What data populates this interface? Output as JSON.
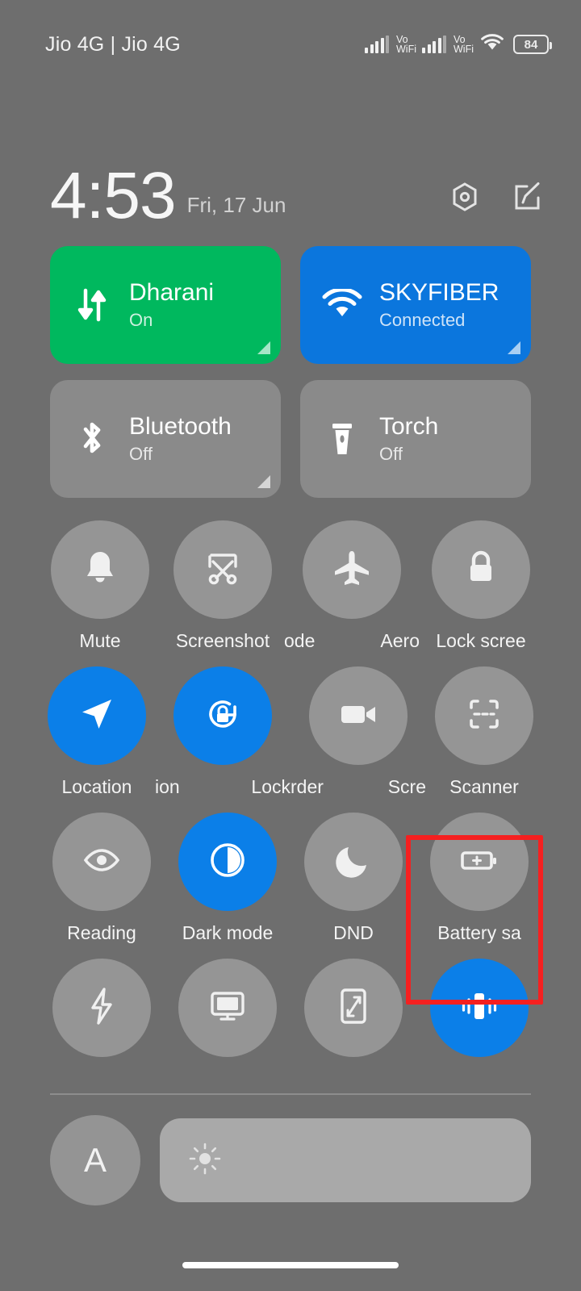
{
  "status_bar": {
    "carrier": "Jio 4G | Jio 4G",
    "signal_1_label": "Vo\nWiFi",
    "vo_top": "Vo",
    "vo_bottom": "WiFi",
    "battery_percent": "84",
    "icons": [
      "signal-bars-icon",
      "vowifi-icon",
      "signal-bars-icon",
      "vowifi-icon",
      "wifi-icon",
      "battery-icon"
    ]
  },
  "header": {
    "time": "4:53",
    "date": "Fri, 17 Jun",
    "settings_icon": "settings-gear-icon",
    "edit_icon": "edit-pencil-icon"
  },
  "big_tiles": [
    {
      "title": "Dharani",
      "subtitle": "On",
      "state": "green",
      "icon": "mobile-data-icon",
      "has_expand": true
    },
    {
      "title": "SKYFIBER",
      "subtitle": "Connected",
      "state": "blue",
      "icon": "wifi-icon",
      "has_expand": true
    },
    {
      "title": "Bluetooth",
      "subtitle": "Off",
      "state": "off",
      "icon": "bluetooth-icon",
      "has_expand": true
    },
    {
      "title": "Torch",
      "subtitle": "Off",
      "state": "off",
      "icon": "torch-icon",
      "has_expand": false
    }
  ],
  "toggle_rows": [
    {
      "tiles": [
        {
          "label": "Mute",
          "icon": "bell-icon",
          "active": false
        },
        {
          "label": "Screenshot",
          "icon": "screenshot-icon",
          "active": false
        },
        {
          "label": "ode",
          "icon": "airplane-icon",
          "active": false
        },
        {
          "label": "Aero",
          "icon": "lock-icon",
          "active": false
        },
        {
          "label": "Lock scree",
          "icon": "lock-icon",
          "active": false
        }
      ]
    }
  ],
  "row1": [
    {
      "label": "Mute",
      "icon": "bell-icon",
      "active": false
    },
    {
      "label": "Screenshot",
      "icon": "screenshot-icon",
      "active": false
    },
    {
      "label": "ode",
      "icon": "airplane-icon",
      "active": false,
      "label2": "Aero"
    },
    {
      "label": "Lock scree",
      "icon": "lock-icon",
      "active": false
    }
  ],
  "row2": [
    {
      "label": "Location",
      "icon": "location-arrow-icon",
      "active": true
    },
    {
      "label": "ion",
      "icon": "rotation-lock-icon",
      "active": true,
      "label2": "Lock"
    },
    {
      "label": "rder",
      "icon": "screen-recorder-icon",
      "active": false,
      "label2": "Scre"
    },
    {
      "label": "Scanner",
      "icon": "scanner-icon",
      "active": false
    }
  ],
  "row3": [
    {
      "label": "Reading",
      "icon": "eye-icon",
      "active": false
    },
    {
      "label": "Dark mode",
      "icon": "dark-mode-icon",
      "active": true
    },
    {
      "label": "DND",
      "icon": "moon-icon",
      "active": false
    },
    {
      "label": "Battery sa",
      "icon": "battery-saver-icon",
      "active": false,
      "highlighted": true
    }
  ],
  "row4": [
    {
      "label": "",
      "icon": "lightning-bolt-icon",
      "active": false
    },
    {
      "label": "",
      "icon": "cast-screen-icon",
      "active": false
    },
    {
      "label": "",
      "icon": "resize-screen-icon",
      "active": false
    },
    {
      "label": "",
      "icon": "vibrate-icon",
      "active": true
    }
  ],
  "brightness": {
    "auto_label": "A",
    "slider_icon": "sun-icon"
  },
  "colors": {
    "background": "#6e6e6e",
    "accent_blue": "#0b7fe8",
    "tile_green": "#00b85e",
    "tile_blue": "#0b76dd",
    "tile_off": "#8a8a8a",
    "highlight_red": "#f52020"
  }
}
